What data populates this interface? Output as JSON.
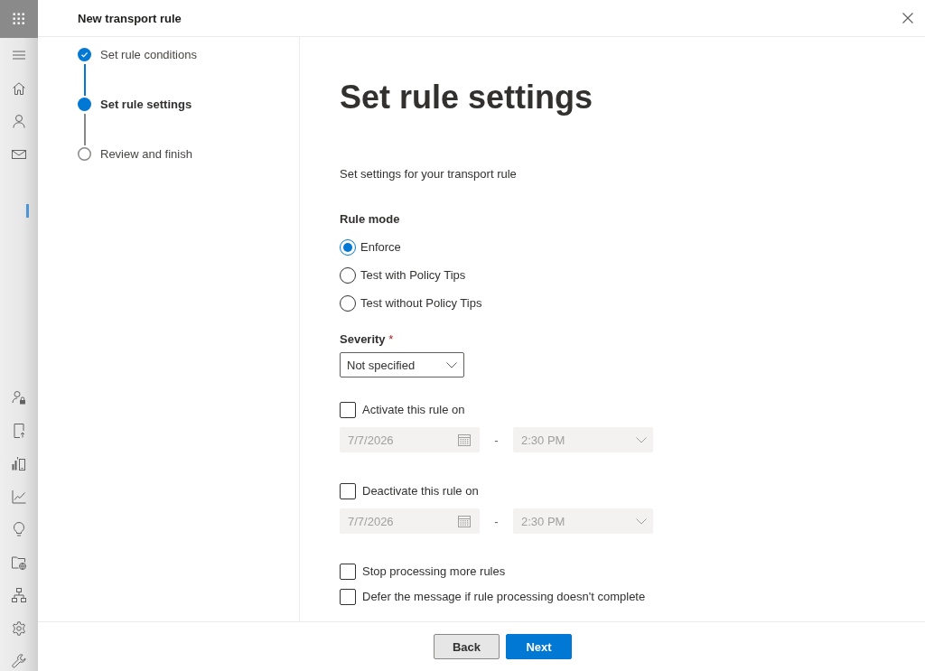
{
  "panel": {
    "title": "New transport rule"
  },
  "steps": [
    {
      "label": "Set rule conditions",
      "completed": true,
      "selected": false
    },
    {
      "label": "Set rule settings",
      "completed": false,
      "selected": true
    },
    {
      "label": "Review and finish",
      "completed": false,
      "selected": false
    }
  ],
  "page": {
    "heading": "Set rule settings",
    "description": "Set settings for your transport rule"
  },
  "rule_mode": {
    "label": "Rule mode",
    "options": [
      {
        "label": "Enforce",
        "selected": true
      },
      {
        "label": "Test with Policy Tips",
        "selected": false
      },
      {
        "label": "Test without Policy Tips",
        "selected": false
      }
    ]
  },
  "severity": {
    "label": "Severity",
    "required_mark": "*",
    "value": "Not specified"
  },
  "schedules": [
    {
      "label": "Activate this rule on",
      "checked": false,
      "date": "7/7/2026",
      "separator": "-",
      "time": "2:30 PM",
      "disabled": true
    },
    {
      "label": "Deactivate this rule on",
      "checked": false,
      "date": "7/7/2026",
      "separator": "-",
      "time": "2:30 PM",
      "disabled": true
    }
  ],
  "options": [
    {
      "label": "Stop processing more rules",
      "checked": false
    },
    {
      "label": "Defer the message if rule processing doesn't complete",
      "checked": false
    }
  ],
  "footer": {
    "buttons": [
      {
        "label": "Back",
        "kind": "secondary"
      },
      {
        "label": "Next",
        "kind": "primary"
      }
    ]
  }
}
